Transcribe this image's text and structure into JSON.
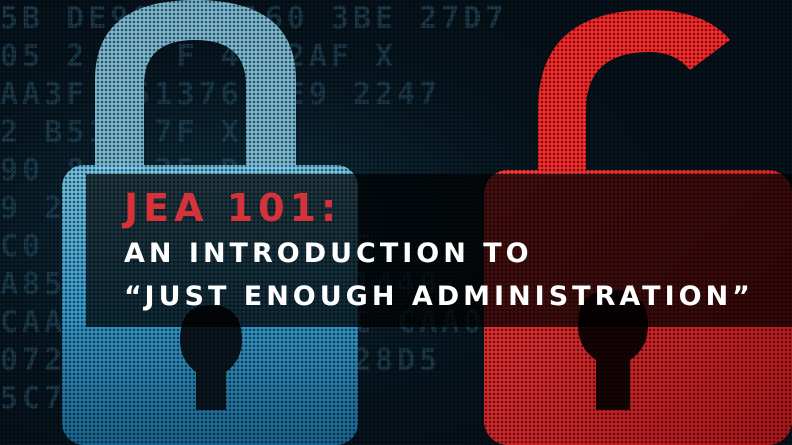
{
  "hero": {
    "title": "JEA 101:",
    "subtitle_line1": "AN INTRODUCTION TO",
    "subtitle_line2": "“JUST ENOUGH ADMINISTRATION”"
  },
  "background_code": [
    "5B  DE905 2F160  3BE  27D7",
    "05 2  X3  F  44  2AF  X",
    "AA3F 351376 DE9  2247",
    "2  B513  7F  X",
    "90 8  4  25  D  ",
    "9 2F  C  8  2",
    "C0  B4E7F 26  F4  DE",
    "A85BECCB  118107  1440",
    "CAA05F28B  86C42CC  CAA05",
    "0722924  687363  228D5",
    "5C77B"
  ],
  "colors": {
    "blue_lock": "#2ea6e6",
    "red_lock": "#e8222a",
    "title": "#d6323a",
    "subtitle": "#ffffff",
    "banner": "#000000"
  },
  "icons": [
    "locked-padlock-icon",
    "unlocked-padlock-icon"
  ]
}
